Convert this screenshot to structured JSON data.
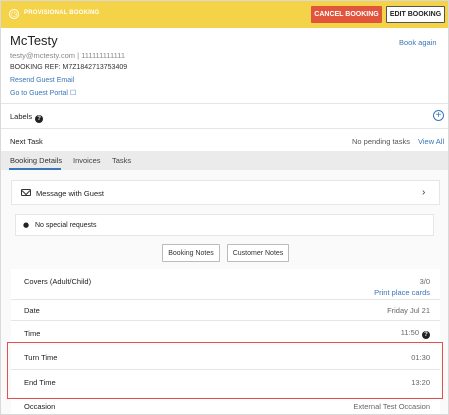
{
  "header": {
    "status": "PROVISIONAL BOOKING",
    "cancel_label": "CANCEL BOOKING",
    "edit_label": "EDIT BOOKING"
  },
  "guest": {
    "name": "McTesty",
    "contact": "testy@mctesty.com | 111111111111",
    "booking_ref": "BOOKING REF: M7Z1842713753409",
    "book_again": "Book again",
    "resend_email": "Resend Guest Email",
    "portal_link": "Go to Guest Portal"
  },
  "labels": {
    "title": "Labels"
  },
  "next_task": {
    "label": "Next Task",
    "status": "No pending tasks",
    "view_all": "View All"
  },
  "tabs": [
    {
      "label": "Booking Details",
      "active": true
    },
    {
      "label": "Invoices",
      "active": false
    },
    {
      "label": "Tasks",
      "active": false
    }
  ],
  "message": {
    "label": "Message with Guest"
  },
  "special_requests": "No special requests",
  "notes": {
    "booking_notes": "Booking Notes",
    "customer_notes": "Customer Notes"
  },
  "details": {
    "covers_label": "Covers (Adult/Child)",
    "covers_value": "3/0",
    "print_place_cards": "Print place cards",
    "date_label": "Date",
    "date_value": "Friday Jul 21",
    "time_label": "Time",
    "time_value": "11:50",
    "turn_time_label": "Turn Time",
    "turn_time_value": "01:30",
    "end_time_label": "End Time",
    "end_time_value": "13:20",
    "occasion_label": "Occasion",
    "occasion_value": "External Test Occasion"
  },
  "colors": {
    "topbar": "#f5d348",
    "cancel": "#e2553d",
    "link": "#3a76b8",
    "highlight": "#e05252"
  }
}
